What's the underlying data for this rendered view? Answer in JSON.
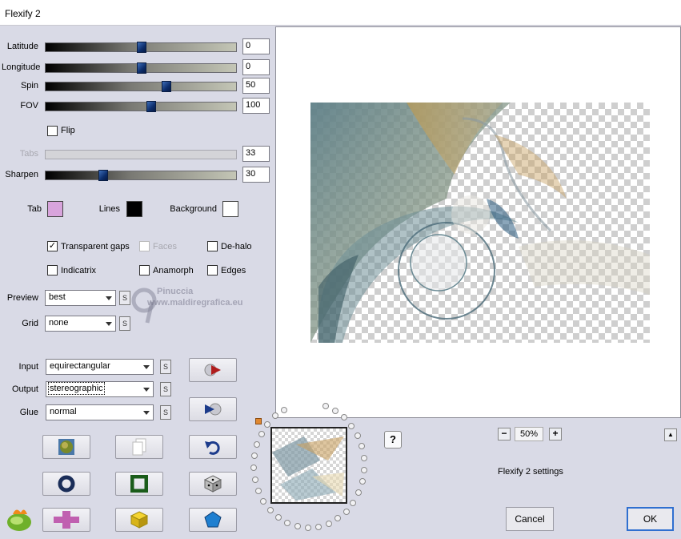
{
  "window": {
    "title": "Flexify 2"
  },
  "sliders": [
    {
      "key": "latitude",
      "label": "Latitude",
      "value": "0",
      "pos": 0.5,
      "enabled": true
    },
    {
      "key": "longitude",
      "label": "Longitude",
      "value": "0",
      "pos": 0.5,
      "enabled": true
    },
    {
      "key": "spin",
      "label": "Spin",
      "value": "50",
      "pos": 0.63,
      "enabled": true
    },
    {
      "key": "fov",
      "label": "FOV",
      "value": "100",
      "pos": 0.55,
      "enabled": true
    },
    {
      "key": "tabs",
      "label": "Tabs",
      "value": "33",
      "pos": null,
      "enabled": false
    },
    {
      "key": "sharpen",
      "label": "Sharpen",
      "value": "30",
      "pos": 0.3,
      "enabled": true
    }
  ],
  "flip": {
    "label": "Flip",
    "checked": false
  },
  "colors": {
    "tab": {
      "label": "Tab",
      "color": "#d8a4dc"
    },
    "lines": {
      "label": "Lines",
      "color": "#000000"
    },
    "background": {
      "label": "Background",
      "color": "#ffffff"
    }
  },
  "options": {
    "transparent_gaps": {
      "label": "Transparent gaps",
      "checked": true,
      "enabled": true
    },
    "faces": {
      "label": "Faces",
      "checked": false,
      "enabled": false
    },
    "de_halo": {
      "label": "De-halo",
      "checked": false,
      "enabled": true
    },
    "indicatrix": {
      "label": "Indicatrix",
      "checked": false,
      "enabled": true
    },
    "anamorph": {
      "label": "Anamorph",
      "checked": false,
      "enabled": true
    },
    "edges": {
      "label": "Edges",
      "checked": false,
      "enabled": true
    }
  },
  "preview_select": {
    "label": "Preview",
    "value": "best"
  },
  "grid_select": {
    "label": "Grid",
    "value": "none"
  },
  "input_select": {
    "label": "Input",
    "value": "equirectangular"
  },
  "output_select": {
    "label": "Output",
    "value": "stereographic"
  },
  "glue_select": {
    "label": "Glue",
    "value": "normal"
  },
  "s_button_label": "S",
  "watermark": {
    "brand": "Pinuccia",
    "url": "www.maldiregrafica.eu"
  },
  "zoom": {
    "value": "50%",
    "minus": "−",
    "plus": "+"
  },
  "status_text": "Flexify 2 settings",
  "help_label": "?",
  "collapse_label": "▲",
  "buttons": {
    "cancel": "Cancel",
    "ok": "OK"
  },
  "tool_icons": [
    "randomize-planet-icon",
    "copy-icon",
    "undo-icon",
    "ring-icon",
    "frame-icon",
    "dice-icon",
    "plus-icon",
    "cube-icon",
    "pentagon-icon"
  ]
}
